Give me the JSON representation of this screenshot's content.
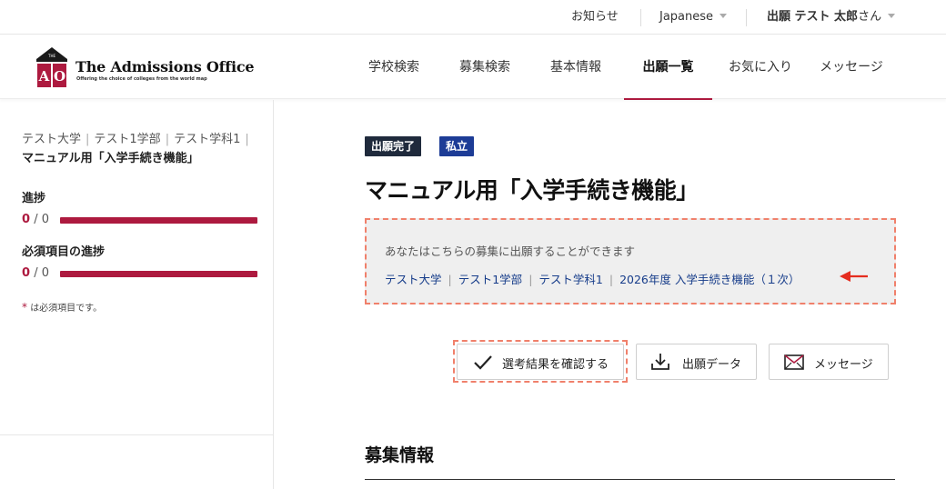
{
  "topbar": {
    "notice": "お知らせ",
    "language": "Japanese",
    "user_name": "出願 テスト 太郎",
    "user_suffix": "さん"
  },
  "brand": {
    "title": "The Admissions Office",
    "tagline": "Offering the choice of colleges from the world map",
    "logo_letters": "AO",
    "logo_small": "THE",
    "accent_color": "#ad1a3f"
  },
  "nav": {
    "items": [
      {
        "label": "学校検索",
        "active": false
      },
      {
        "label": "募集検索",
        "active": false
      },
      {
        "label": "基本情報",
        "active": false
      },
      {
        "label": "出願一覧",
        "active": true
      },
      {
        "label": "お気に入り",
        "active": false
      },
      {
        "label": "メッセージ",
        "active": false
      }
    ]
  },
  "sidebar": {
    "breadcrumb": [
      "テスト大学",
      "テスト1学部",
      "テスト学科1"
    ],
    "breadcrumb_separator": "|",
    "breadcrumb_current": "マニュアル用「入学手続き機能」",
    "progress": {
      "label": "進捗",
      "done": "0",
      "total": "/ 0",
      "fraction_complete": 0
    },
    "required_progress": {
      "label": "必須項目の進捗",
      "done": "0",
      "total": "/ 0",
      "fraction_complete": 0
    },
    "required_note_mark": "*",
    "required_note": "は必須項目です。"
  },
  "main": {
    "badges": [
      {
        "label": "出願完了",
        "color": "#1f2a3c"
      },
      {
        "label": "私立",
        "color": "#1d3c96"
      }
    ],
    "title": "マニュアル用「入学手続き機能」",
    "notice": {
      "text": "あなたはこちらの募集に出願することができます",
      "path": [
        "テスト大学",
        "テスト1学部",
        "テスト学科1",
        "2026年度 入学手続き機能（１次）"
      ],
      "separator": "|",
      "arrow_color": "#e52d1f"
    },
    "buttons": {
      "check_result": "選考結果を確認する",
      "application_data": "出願データ",
      "message": "メッセージ"
    },
    "section_title": "募集情報"
  }
}
